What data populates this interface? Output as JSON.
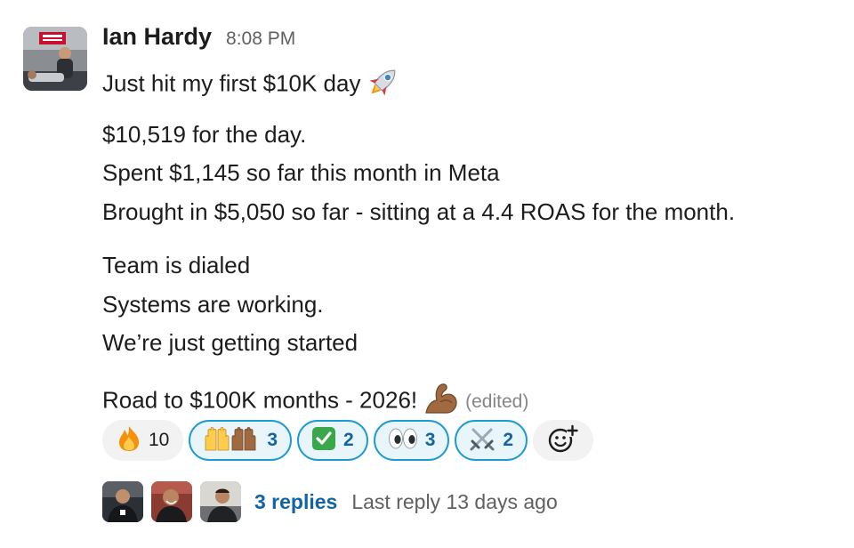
{
  "message": {
    "sender": "Ian Hardy",
    "timestamp": "8:08 PM",
    "lines": {
      "l1": "Just hit my first $10K day",
      "l2": "$10,519 for the day.",
      "l3": "Spent $1,145 so far this month in Meta",
      "l4": "Brought in $5,050 so far - sitting at a 4.4 ROAS for the month.",
      "l5": "Team is dialed",
      "l6": "Systems are working.",
      "l7": "We’re just getting started",
      "l8": "Road to $100K months - 2026!"
    },
    "inline_emoji": {
      "after_l1": "rocket-emoji",
      "after_l8": "flexed-biceps-emoji"
    },
    "edited_label": "(edited)"
  },
  "reactions": [
    {
      "emoji": "fire",
      "count": "10",
      "mine": false
    },
    {
      "emoji": "raising-hands",
      "count": "3",
      "mine": true
    },
    {
      "emoji": "white-check-mark",
      "count": "2",
      "mine": true
    },
    {
      "emoji": "eyes",
      "count": "3",
      "mine": true
    },
    {
      "emoji": "crossed-swords",
      "count": "2",
      "mine": true
    }
  ],
  "add_reaction_icon": "add-reaction-icon",
  "thread": {
    "replies_label": "3 replies",
    "last_reply": "Last reply 13 days ago"
  },
  "colors": {
    "link": "#1264a3",
    "reaction_mine_border": "#1d9bd1",
    "reaction_mine_bg": "#e8f5fa",
    "reaction_bg": "#f2f2f2",
    "muted_text": "#616061"
  }
}
